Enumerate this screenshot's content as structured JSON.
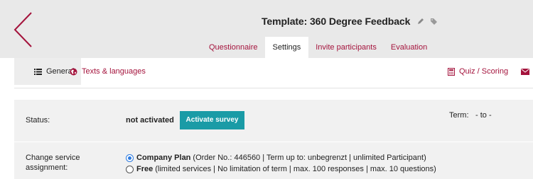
{
  "header": {
    "title": "Template: 360 Degree Feedback",
    "icons": [
      "back-chevron-icon",
      "pencil-icon",
      "tag-icon"
    ]
  },
  "tabs": [
    {
      "label": "Questionnaire",
      "active": false
    },
    {
      "label": "Settings",
      "active": true
    },
    {
      "label": "Invite participants",
      "active": false
    },
    {
      "label": "Evaluation",
      "active": false
    }
  ],
  "subnav": {
    "general": "General",
    "texts_languages": "Texts & languages",
    "quiz_scoring": "Quiz / Scoring"
  },
  "settings": {
    "status_label": "Status:",
    "status_value": "not activated",
    "activate_button": "Activate survey",
    "term_label": "Term:",
    "term_value": "- to -",
    "service_label_line1": "Change service",
    "service_label_line2": "assignment:",
    "options": [
      {
        "name": "Company Plan",
        "details": "(Order No.: 446560 | Term up to: unbegrenzt | unlimited Participant)",
        "selected": true
      },
      {
        "name": "Free",
        "details": "(limited services | No limitation of term | max. 100 responses | max. 10 questions)",
        "selected": false
      }
    ]
  },
  "colors": {
    "accent": "#a4133c",
    "button": "#1a9ba6",
    "header_bg": "#e9e9e9",
    "panel_bg": "#f1f1f1"
  }
}
